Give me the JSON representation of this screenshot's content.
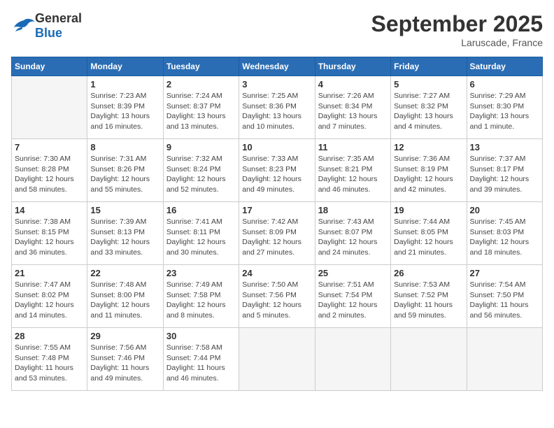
{
  "header": {
    "logo_general": "General",
    "logo_blue": "Blue",
    "month_title": "September 2025",
    "location": "Laruscade, France"
  },
  "calendar": {
    "days_of_week": [
      "Sunday",
      "Monday",
      "Tuesday",
      "Wednesday",
      "Thursday",
      "Friday",
      "Saturday"
    ],
    "weeks": [
      [
        {
          "day": "",
          "info": ""
        },
        {
          "day": "1",
          "info": "Sunrise: 7:23 AM\nSunset: 8:39 PM\nDaylight: 13 hours\nand 16 minutes."
        },
        {
          "day": "2",
          "info": "Sunrise: 7:24 AM\nSunset: 8:37 PM\nDaylight: 13 hours\nand 13 minutes."
        },
        {
          "day": "3",
          "info": "Sunrise: 7:25 AM\nSunset: 8:36 PM\nDaylight: 13 hours\nand 10 minutes."
        },
        {
          "day": "4",
          "info": "Sunrise: 7:26 AM\nSunset: 8:34 PM\nDaylight: 13 hours\nand 7 minutes."
        },
        {
          "day": "5",
          "info": "Sunrise: 7:27 AM\nSunset: 8:32 PM\nDaylight: 13 hours\nand 4 minutes."
        },
        {
          "day": "6",
          "info": "Sunrise: 7:29 AM\nSunset: 8:30 PM\nDaylight: 13 hours\nand 1 minute."
        }
      ],
      [
        {
          "day": "7",
          "info": "Sunrise: 7:30 AM\nSunset: 8:28 PM\nDaylight: 12 hours\nand 58 minutes."
        },
        {
          "day": "8",
          "info": "Sunrise: 7:31 AM\nSunset: 8:26 PM\nDaylight: 12 hours\nand 55 minutes."
        },
        {
          "day": "9",
          "info": "Sunrise: 7:32 AM\nSunset: 8:24 PM\nDaylight: 12 hours\nand 52 minutes."
        },
        {
          "day": "10",
          "info": "Sunrise: 7:33 AM\nSunset: 8:23 PM\nDaylight: 12 hours\nand 49 minutes."
        },
        {
          "day": "11",
          "info": "Sunrise: 7:35 AM\nSunset: 8:21 PM\nDaylight: 12 hours\nand 46 minutes."
        },
        {
          "day": "12",
          "info": "Sunrise: 7:36 AM\nSunset: 8:19 PM\nDaylight: 12 hours\nand 42 minutes."
        },
        {
          "day": "13",
          "info": "Sunrise: 7:37 AM\nSunset: 8:17 PM\nDaylight: 12 hours\nand 39 minutes."
        }
      ],
      [
        {
          "day": "14",
          "info": "Sunrise: 7:38 AM\nSunset: 8:15 PM\nDaylight: 12 hours\nand 36 minutes."
        },
        {
          "day": "15",
          "info": "Sunrise: 7:39 AM\nSunset: 8:13 PM\nDaylight: 12 hours\nand 33 minutes."
        },
        {
          "day": "16",
          "info": "Sunrise: 7:41 AM\nSunset: 8:11 PM\nDaylight: 12 hours\nand 30 minutes."
        },
        {
          "day": "17",
          "info": "Sunrise: 7:42 AM\nSunset: 8:09 PM\nDaylight: 12 hours\nand 27 minutes."
        },
        {
          "day": "18",
          "info": "Sunrise: 7:43 AM\nSunset: 8:07 PM\nDaylight: 12 hours\nand 24 minutes."
        },
        {
          "day": "19",
          "info": "Sunrise: 7:44 AM\nSunset: 8:05 PM\nDaylight: 12 hours\nand 21 minutes."
        },
        {
          "day": "20",
          "info": "Sunrise: 7:45 AM\nSunset: 8:03 PM\nDaylight: 12 hours\nand 18 minutes."
        }
      ],
      [
        {
          "day": "21",
          "info": "Sunrise: 7:47 AM\nSunset: 8:02 PM\nDaylight: 12 hours\nand 14 minutes."
        },
        {
          "day": "22",
          "info": "Sunrise: 7:48 AM\nSunset: 8:00 PM\nDaylight: 12 hours\nand 11 minutes."
        },
        {
          "day": "23",
          "info": "Sunrise: 7:49 AM\nSunset: 7:58 PM\nDaylight: 12 hours\nand 8 minutes."
        },
        {
          "day": "24",
          "info": "Sunrise: 7:50 AM\nSunset: 7:56 PM\nDaylight: 12 hours\nand 5 minutes."
        },
        {
          "day": "25",
          "info": "Sunrise: 7:51 AM\nSunset: 7:54 PM\nDaylight: 12 hours\nand 2 minutes."
        },
        {
          "day": "26",
          "info": "Sunrise: 7:53 AM\nSunset: 7:52 PM\nDaylight: 11 hours\nand 59 minutes."
        },
        {
          "day": "27",
          "info": "Sunrise: 7:54 AM\nSunset: 7:50 PM\nDaylight: 11 hours\nand 56 minutes."
        }
      ],
      [
        {
          "day": "28",
          "info": "Sunrise: 7:55 AM\nSunset: 7:48 PM\nDaylight: 11 hours\nand 53 minutes."
        },
        {
          "day": "29",
          "info": "Sunrise: 7:56 AM\nSunset: 7:46 PM\nDaylight: 11 hours\nand 49 minutes."
        },
        {
          "day": "30",
          "info": "Sunrise: 7:58 AM\nSunset: 7:44 PM\nDaylight: 11 hours\nand 46 minutes."
        },
        {
          "day": "",
          "info": ""
        },
        {
          "day": "",
          "info": ""
        },
        {
          "day": "",
          "info": ""
        },
        {
          "day": "",
          "info": ""
        }
      ]
    ]
  }
}
